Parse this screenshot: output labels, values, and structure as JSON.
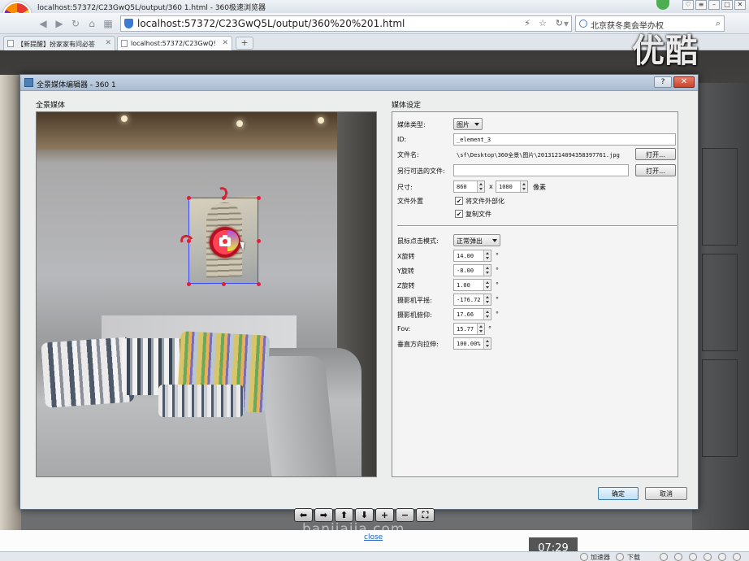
{
  "browser": {
    "window_title": "localhost:57372/C23GwQ5L/output/360  1.html - 360极速浏览器",
    "address": "localhost:57372/C23GwQ5L/output/360%20%201.html",
    "search_text": "北京获冬奥会举办权",
    "tabs": [
      {
        "label": "【新提醒】扮家家有问必答"
      },
      {
        "label": "localhost:57372/C23GwQ!"
      }
    ],
    "new_tab": "+",
    "overlay_brand": "优酷"
  },
  "dialog": {
    "title": "全景媒体编辑器 - 360  1",
    "help": "?",
    "close": "✕",
    "left_group": "全景媒体",
    "right_group": "媒体设定",
    "settings": {
      "media_type_label": "媒体类型:",
      "media_type_value": "图片",
      "id_label": "ID:",
      "id_value": "_element_3",
      "filename_label": "文件名:",
      "filename_value": "\\sf\\Desktop\\360全景\\图片\\20131214094358397761.jpg",
      "open_btn": "打开...",
      "alt_file_label": "另行可选的文件:",
      "alt_file_value": "",
      "open_btn2": "打开...",
      "size_label": "尺寸:",
      "width": "860",
      "x_sep": "x",
      "height": "1080",
      "pixel_unit": "像素",
      "appearance_label": "文件外置",
      "externalize_label": "将文件外部化",
      "externalize_checked": true,
      "copy_label": "复制文件",
      "copy_checked": true,
      "click_mode_label": "鼠标点击模式:",
      "click_mode_value": "正常弹出",
      "x_rot_label": "X旋转",
      "x_rot_value": "14.00",
      "y_rot_label": "Y旋转",
      "y_rot_value": "-8.00",
      "z_rot_label": "Z旋转",
      "z_rot_value": "1.00",
      "pan_label": "摄影机平摇:",
      "pan_value": "-176.72",
      "tilt_label": "摄影机俯仰:",
      "tilt_value": "17.66",
      "fov_label": "Fov:",
      "fov_value": "15.77",
      "stretch_label": "垂直方向拉伸:",
      "stretch_value": "100.00%",
      "degree": "°"
    },
    "ok": "确定",
    "cancel": "取消"
  },
  "viewer": {
    "controls": [
      "⬅",
      "➡",
      "⬆",
      "⬇",
      "+",
      "−",
      "⛶"
    ],
    "watermark": "banjiajia.com",
    "close_link": "close",
    "timestamp": "07:29"
  },
  "statusbar": {
    "accelerator": "加速器",
    "download": "下载"
  }
}
